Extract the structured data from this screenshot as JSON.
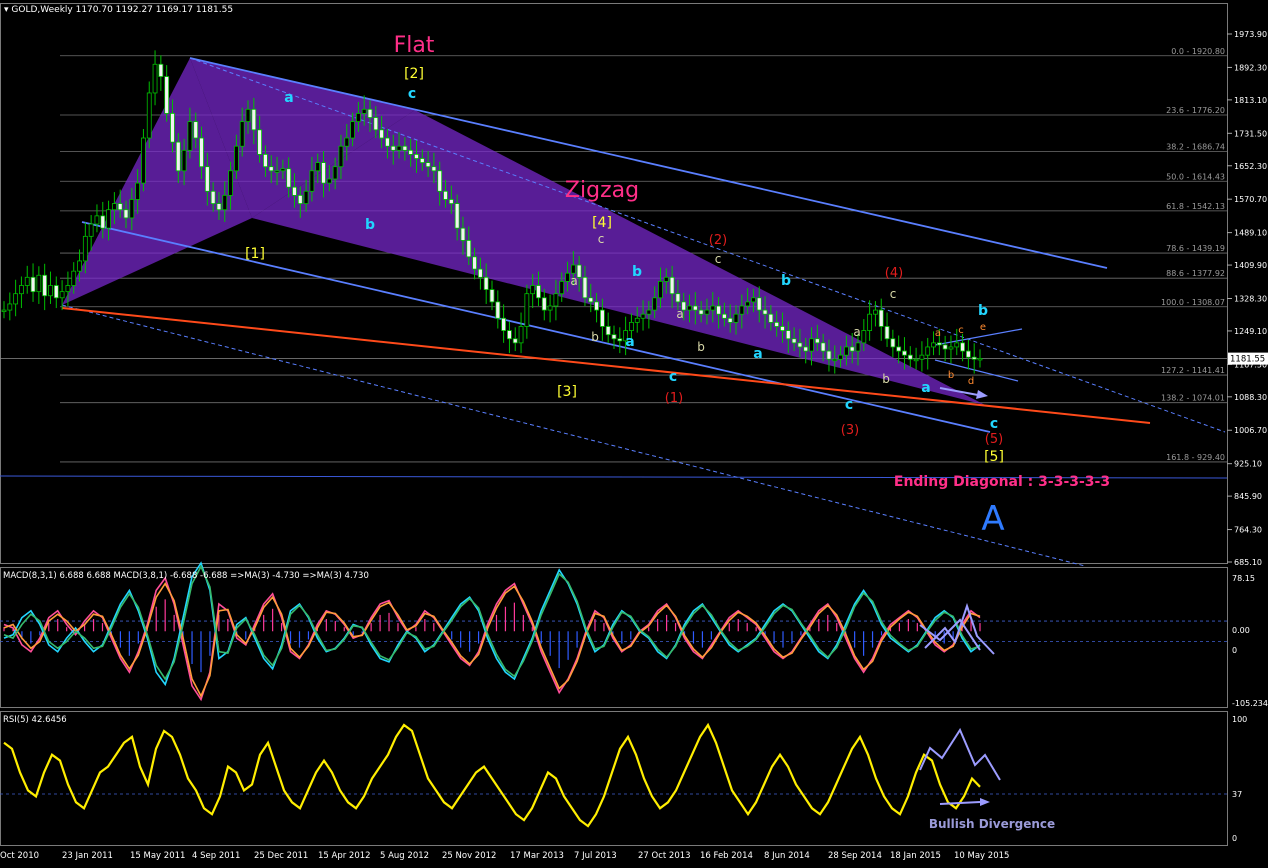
{
  "window": {
    "header": "GOLD,Weekly  1170.70 1192.27 1169.17 1181.55"
  },
  "colors": {
    "background": "#000000",
    "candles": "#00c000",
    "channel": "#5a7fff",
    "fib": "#6f6f6f",
    "support": "#ff4a1a",
    "wedge_fill": "#7a28d0",
    "label_yellow": "#ffff33",
    "label_cyan": "#22d6ff",
    "label_red": "#e31d1d",
    "label_pink": "#ff2f88",
    "label_orange": "#ff8a30",
    "rsi_line": "#ffee00",
    "arrow": "#9c9cff"
  },
  "chart_data": [
    {
      "type": "line",
      "title": "GOLD,Weekly",
      "quote": {
        "open": 1170.7,
        "high": 1192.27,
        "low": 1169.17,
        "close": 1181.55
      },
      "price_axis_ticks": [
        "1973.90",
        "1892.30",
        "1813.10",
        "1731.50",
        "1652.30",
        "1570.70",
        "1489.10",
        "1409.90",
        "1328.30",
        "1249.10",
        "1167.50",
        "1088.30",
        "1006.70",
        "925.10",
        "845.90",
        "764.30",
        "685.10"
      ],
      "current_price": "1181.55",
      "time_axis_ticks": [
        "Oct 2010",
        "23 Jan 2011",
        "15 May 2011",
        "4 Sep 2011",
        "25 Dec 2011",
        "15 Apr 2012",
        "5 Aug 2012",
        "25 Nov 2012",
        "17 Mar 2013",
        "7 Jul 2013",
        "27 Oct 2013",
        "16 Feb 2014",
        "8 Jun 2014",
        "28 Sep 2014",
        "18 Jan 2015",
        "10 May 2015"
      ],
      "fib_levels": [
        "0.0 - 1920.80",
        "23.6 - 1776.20",
        "38.2 - 1686.74",
        "50.0 - 1614.43",
        "61.8 - 1542.13",
        "78.6 - 1439.19",
        "88.6 - 1377.92",
        "100.0 - 1308.07",
        "127.2 - 1141.41",
        "138.2 - 1074.01",
        "161.8 - 929.40"
      ],
      "series": [
        {
          "values": [
            1300,
            1315,
            1340,
            1360,
            1380,
            1345,
            1385,
            1335,
            1360,
            1330,
            1345,
            1360,
            1395,
            1420,
            1480,
            1510,
            1530,
            1500,
            1545,
            1560,
            1545,
            1525,
            1570,
            1610,
            1720,
            1830,
            1900,
            1870,
            1780,
            1710,
            1640,
            1690,
            1760,
            1720,
            1650,
            1590,
            1560,
            1545,
            1580,
            1640,
            1700,
            1760,
            1790,
            1740,
            1680,
            1650,
            1640,
            1640,
            1645,
            1600,
            1580,
            1560,
            1590,
            1640,
            1660,
            1610,
            1620,
            1650,
            1700,
            1720,
            1760,
            1780,
            1790,
            1770,
            1740,
            1720,
            1700,
            1690,
            1700,
            1690,
            1680,
            1670,
            1660,
            1650,
            1640,
            1590,
            1570,
            1560,
            1500,
            1470,
            1430,
            1400,
            1380,
            1350,
            1320,
            1280,
            1250,
            1230,
            1220,
            1260,
            1340,
            1360,
            1330,
            1300,
            1310,
            1340,
            1370,
            1390,
            1410,
            1380,
            1330,
            1320,
            1300,
            1260,
            1240,
            1230,
            1225,
            1250,
            1270,
            1280,
            1290,
            1300,
            1330,
            1370,
            1380,
            1340,
            1320,
            1300,
            1310,
            1300,
            1290,
            1300,
            1310,
            1290,
            1280,
            1270,
            1290,
            1310,
            1320,
            1330,
            1300,
            1290,
            1270,
            1260,
            1250,
            1230,
            1220,
            1210,
            1200,
            1230,
            1220,
            1200,
            1180,
            1180,
            1190,
            1210,
            1200,
            1220,
            1250,
            1290,
            1300,
            1260,
            1230,
            1210,
            1200,
            1190,
            1180,
            1180,
            1190,
            1210,
            1220,
            1215,
            1205,
            1210,
            1220,
            1200,
            1185,
            1180,
            1182
          ]
        }
      ]
    },
    {
      "type": "line",
      "title": "MACD(8,3,1) 6.688 6.688  MACD(3,8,1) -6.688 -6.688  =>MA(3) -4.730  =>MA(3) 4.730",
      "axis_ticks": [
        "78.15",
        "0.00",
        "0",
        "-105.234"
      ],
      "series": [
        {
          "values": [
            10,
            5,
            -20,
            -30,
            -10,
            20,
            30,
            10,
            -5,
            15,
            30,
            20,
            -10,
            -40,
            -60,
            -30,
            10,
            60,
            78,
            40,
            -20,
            -80,
            -100,
            -60,
            40,
            30,
            -10,
            -20,
            10,
            40,
            55,
            20,
            -30,
            -40,
            -20,
            10,
            30,
            25,
            10,
            -10,
            -5,
            20,
            40,
            45,
            20,
            0,
            10,
            30,
            20,
            0,
            -20,
            -40,
            -50,
            -30,
            10,
            40,
            60,
            70,
            40,
            10,
            -30,
            -60,
            -90,
            -70,
            -40,
            0,
            30,
            20,
            -10,
            -30,
            -20,
            0,
            10,
            30,
            40,
            20,
            -10,
            -30,
            -40,
            -20,
            0,
            20,
            30,
            20,
            10,
            -10,
            -30,
            -40,
            -30,
            -10,
            10,
            30,
            40,
            20,
            -10,
            -40,
            -60,
            -40,
            -10,
            10,
            20,
            30,
            20,
            0,
            -20,
            -30,
            -20,
            10,
            30,
            20
          ]
        },
        {
          "values": [
            5,
            10,
            -10,
            -25,
            -15,
            15,
            25,
            15,
            0,
            10,
            25,
            22,
            -5,
            -35,
            -55,
            -35,
            5,
            50,
            70,
            45,
            -10,
            -70,
            -95,
            -65,
            30,
            32,
            -5,
            -18,
            5,
            35,
            50,
            25,
            -25,
            -38,
            -22,
            5,
            28,
            26,
            12,
            -8,
            -6,
            16,
            36,
            42,
            24,
            2,
            8,
            26,
            22,
            2,
            -16,
            -36,
            -48,
            -34,
            4,
            34,
            56,
            66,
            44,
            14,
            -24,
            -54,
            -84,
            -72,
            -44,
            -4,
            26,
            22,
            -6,
            -28,
            -22,
            -2,
            8,
            26,
            38,
            22,
            -6,
            -26,
            -38,
            -24,
            -2,
            16,
            28,
            22,
            12,
            -6,
            -26,
            -38,
            -32,
            -12,
            6,
            26,
            38,
            24,
            -4,
            -36,
            -56,
            -44,
            -14,
            6,
            18,
            28,
            22,
            2,
            -16,
            -28,
            -22,
            6,
            26,
            22
          ]
        }
      ]
    },
    {
      "type": "line",
      "title": "RSI(5) 42.6456",
      "axis_ticks": [
        "100",
        "37",
        "0"
      ],
      "series": [
        {
          "values": [
            80,
            75,
            55,
            40,
            35,
            55,
            70,
            65,
            45,
            30,
            25,
            40,
            55,
            60,
            70,
            80,
            85,
            60,
            45,
            75,
            90,
            85,
            70,
            50,
            40,
            25,
            20,
            35,
            60,
            55,
            40,
            45,
            70,
            80,
            60,
            40,
            30,
            25,
            40,
            55,
            65,
            55,
            40,
            30,
            25,
            35,
            50,
            60,
            70,
            85,
            95,
            90,
            70,
            50,
            40,
            30,
            25,
            35,
            45,
            55,
            60,
            50,
            40,
            30,
            20,
            15,
            25,
            40,
            55,
            50,
            35,
            25,
            15,
            10,
            20,
            35,
            55,
            75,
            85,
            70,
            50,
            35,
            25,
            30,
            40,
            55,
            70,
            85,
            95,
            80,
            60,
            40,
            30,
            20,
            30,
            45,
            60,
            70,
            60,
            45,
            35,
            25,
            20,
            30,
            45,
            60,
            75,
            85,
            70,
            50,
            35,
            25,
            20,
            35,
            55,
            70,
            65,
            45,
            30,
            25,
            35,
            50,
            43
          ]
        }
      ]
    }
  ],
  "annotations": {
    "flat": "Flat",
    "zigzag": "Zigzag",
    "w2": "[2]",
    "w1": "[1]",
    "w3": "[3]",
    "w4": "[4]",
    "w5": "[5]",
    "r2": "(2)",
    "r3": "(3)",
    "r4": "(4)",
    "r5": "(5)",
    "r1": "(1)",
    "big_a": "A",
    "ending_diagonal": "Ending Diagonal : 3-3-3-3-3",
    "bullish_divergence": "Bullish Divergence",
    "lc_a": "a",
    "lc_b": "b",
    "lc_c": "c",
    "lc_d": "d",
    "lc_e": "e"
  }
}
